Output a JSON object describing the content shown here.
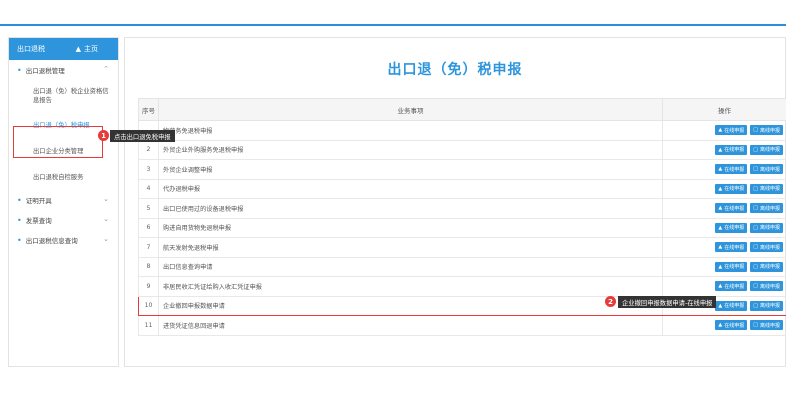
{
  "sidebar": {
    "header_title": "出口退税",
    "home_label": "主页",
    "groups": [
      {
        "label": "出口退税管理"
      },
      {
        "label": "证明开具"
      },
      {
        "label": "发票查询"
      },
      {
        "label": "出口退税信息查询"
      }
    ],
    "items": [
      {
        "label": "出口退（免）税企业资格信息报告"
      },
      {
        "label": "出口退（免）税申报"
      },
      {
        "label": "出口企业分类管理"
      },
      {
        "label": "出口退税自检服务"
      }
    ]
  },
  "main": {
    "title": "出口退（免）税申报",
    "columns": [
      "序号",
      "业务事项",
      "操作"
    ],
    "buttons": {
      "online": "在线申报",
      "offline": "离线申报"
    },
    "rows": [
      {
        "num": "",
        "name": "物劳务免退税申报"
      },
      {
        "num": "2",
        "name": "外贸企业外购服务免退税申报"
      },
      {
        "num": "3",
        "name": "外贸企业调整申报"
      },
      {
        "num": "4",
        "name": "代办退税申报"
      },
      {
        "num": "5",
        "name": "出口已使用过的设备退税申报"
      },
      {
        "num": "6",
        "name": "购进自用货物免退税申报"
      },
      {
        "num": "7",
        "name": "航天发射免退税申报"
      },
      {
        "num": "8",
        "name": "出口信息查询申请"
      },
      {
        "num": "9",
        "name": "非居民收汇凭证给购入收汇凭证申报"
      },
      {
        "num": "10",
        "name": "企业撤回申报数据申请"
      },
      {
        "num": "11",
        "name": "进货凭证信息回退申请"
      }
    ]
  },
  "annotations": {
    "badge1": "1",
    "tip1": "点击出口退免税申报",
    "badge2": "2",
    "tip2": "企业撤回申报数据申请-在线申报"
  },
  "colors": {
    "accent": "#2e95dc",
    "highlight": "#e63b3b"
  }
}
